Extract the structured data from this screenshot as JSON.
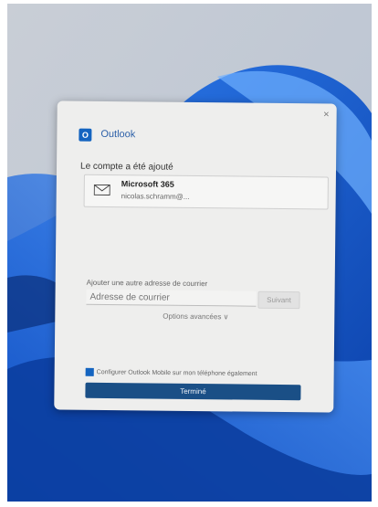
{
  "window": {
    "app_name": "Outlook",
    "logo_letter": "O",
    "close_glyph": "×"
  },
  "status": {
    "heading": "Le compte a été ajouté"
  },
  "account": {
    "name": "Microsoft 365",
    "email": "nicolas.schramm@...",
    "icon": "mail-icon"
  },
  "add_account": {
    "label": "Ajouter une autre adresse de courrier",
    "placeholder": "Adresse de courrier",
    "connect_label": "Suivant",
    "advanced_label": "Options avancées ∨"
  },
  "mobile": {
    "checkbox_label": "Configurer Outlook Mobile sur mon téléphone également",
    "checked": true
  },
  "footer": {
    "done_label": "Terminé"
  },
  "colors": {
    "accent": "#1464c0",
    "done_button": "#1a4f86",
    "wallpaper": "#1565d8"
  }
}
